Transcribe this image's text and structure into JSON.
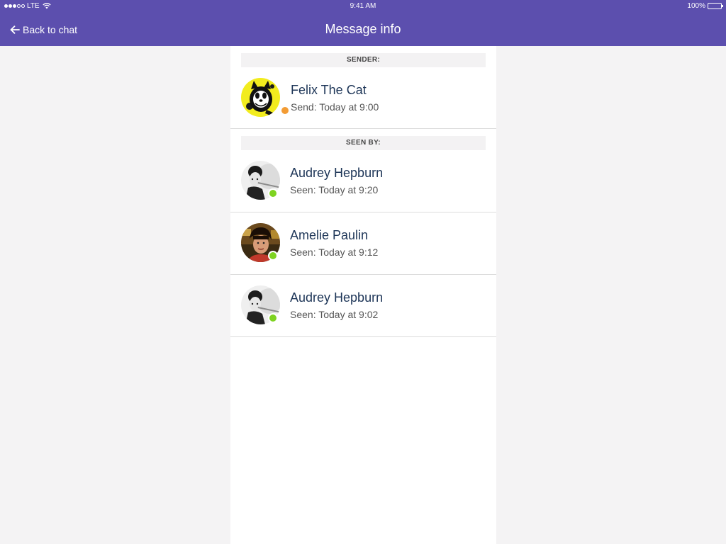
{
  "status_bar": {
    "carrier": "LTE",
    "time": "9:41 AM",
    "battery": "100%",
    "signal_bars": 3,
    "signal_total": 5,
    "battery_level": 1.0
  },
  "nav": {
    "back_label": "Back to chat",
    "title": "Message info"
  },
  "colors": {
    "nav_background": "#5c4fae",
    "page_background": "#f4f3f4",
    "name_text": "#1d3557",
    "status_away": "#f39c34",
    "status_online": "#7ed321"
  },
  "sender_section": {
    "header": "SENDER:",
    "sender": {
      "name": "Felix The Cat",
      "meta": "Send: Today at 9:00",
      "status": "away",
      "avatar": "felix-avatar"
    }
  },
  "seen_section": {
    "header": "SEEN BY:",
    "viewers": [
      {
        "name": "Audrey Hepburn",
        "meta": "Seen: Today at 9:20",
        "status": "online",
        "avatar": "audrey-avatar"
      },
      {
        "name": "Amelie Paulin",
        "meta": "Seen: Today at 9:12",
        "status": "online",
        "avatar": "amelie-avatar"
      },
      {
        "name": "Audrey Hepburn",
        "meta": "Seen: Today at 9:02",
        "status": "online",
        "avatar": "audrey-avatar"
      }
    ]
  }
}
